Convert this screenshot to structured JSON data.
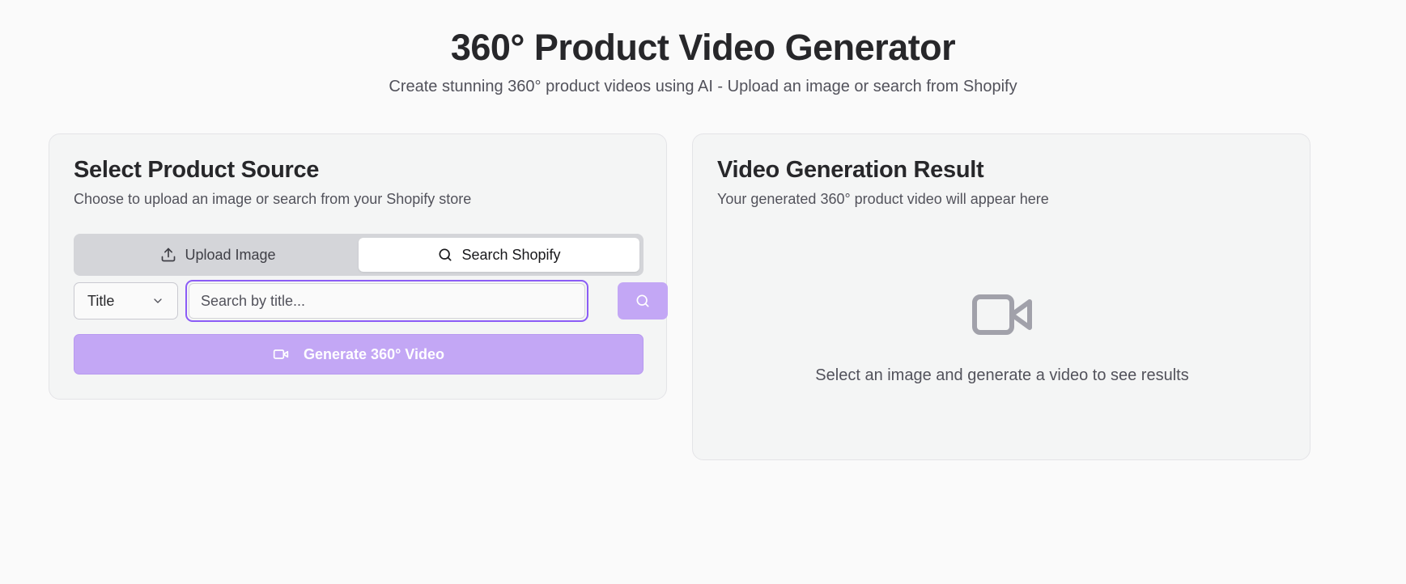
{
  "header": {
    "title": "360° Product Video Generator",
    "subtitle": "Create stunning 360° product videos using AI - Upload an image or search from Shopify"
  },
  "source_card": {
    "title": "Select Product Source",
    "description": "Choose to upload an image or search from your Shopify store",
    "tabs": [
      {
        "label": "Upload Image",
        "icon": "upload-icon",
        "active": false
      },
      {
        "label": "Search Shopify",
        "icon": "search-icon",
        "active": true
      }
    ],
    "search": {
      "field_select_value": "Title",
      "placeholder": "Search by title...",
      "value": ""
    },
    "generate_label": "Generate 360° Video"
  },
  "result_card": {
    "title": "Video Generation Result",
    "description": "Your generated 360° product video will appear here",
    "empty_message": "Select an image and generate a video to see results"
  },
  "colors": {
    "accent": "#8b5cf6",
    "accent_disabled": "#c3a7f5",
    "background": "#fafafa",
    "card": "#f4f5f5"
  }
}
